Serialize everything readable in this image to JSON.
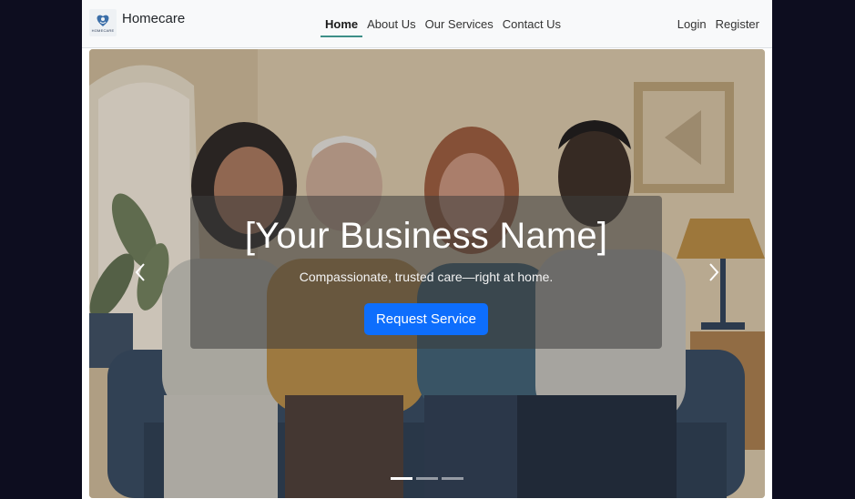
{
  "navbar": {
    "brand_name": "Homecare",
    "logo_text": "HOMECARE",
    "links": [
      {
        "label": "Home",
        "active": true
      },
      {
        "label": "About Us",
        "active": false
      },
      {
        "label": "Our Services",
        "active": false
      },
      {
        "label": "Contact Us",
        "active": false
      }
    ],
    "right_links": [
      {
        "label": "Login"
      },
      {
        "label": "Register"
      }
    ]
  },
  "hero": {
    "title": "[Your Business Name]",
    "subtitle": "Compassionate, trusted care—right at home.",
    "cta_label": "Request Service",
    "slide_count": 3,
    "active_slide": 1
  },
  "icons": {
    "prev": "chevron-left-icon",
    "next": "chevron-right-icon",
    "logo": "homecare-logo-icon"
  },
  "colors": {
    "navbar_bg": "#f8f9fa",
    "active_underline": "#3d8f88",
    "cta": "#0d6efd",
    "page_bg": "#0d0d1f"
  }
}
